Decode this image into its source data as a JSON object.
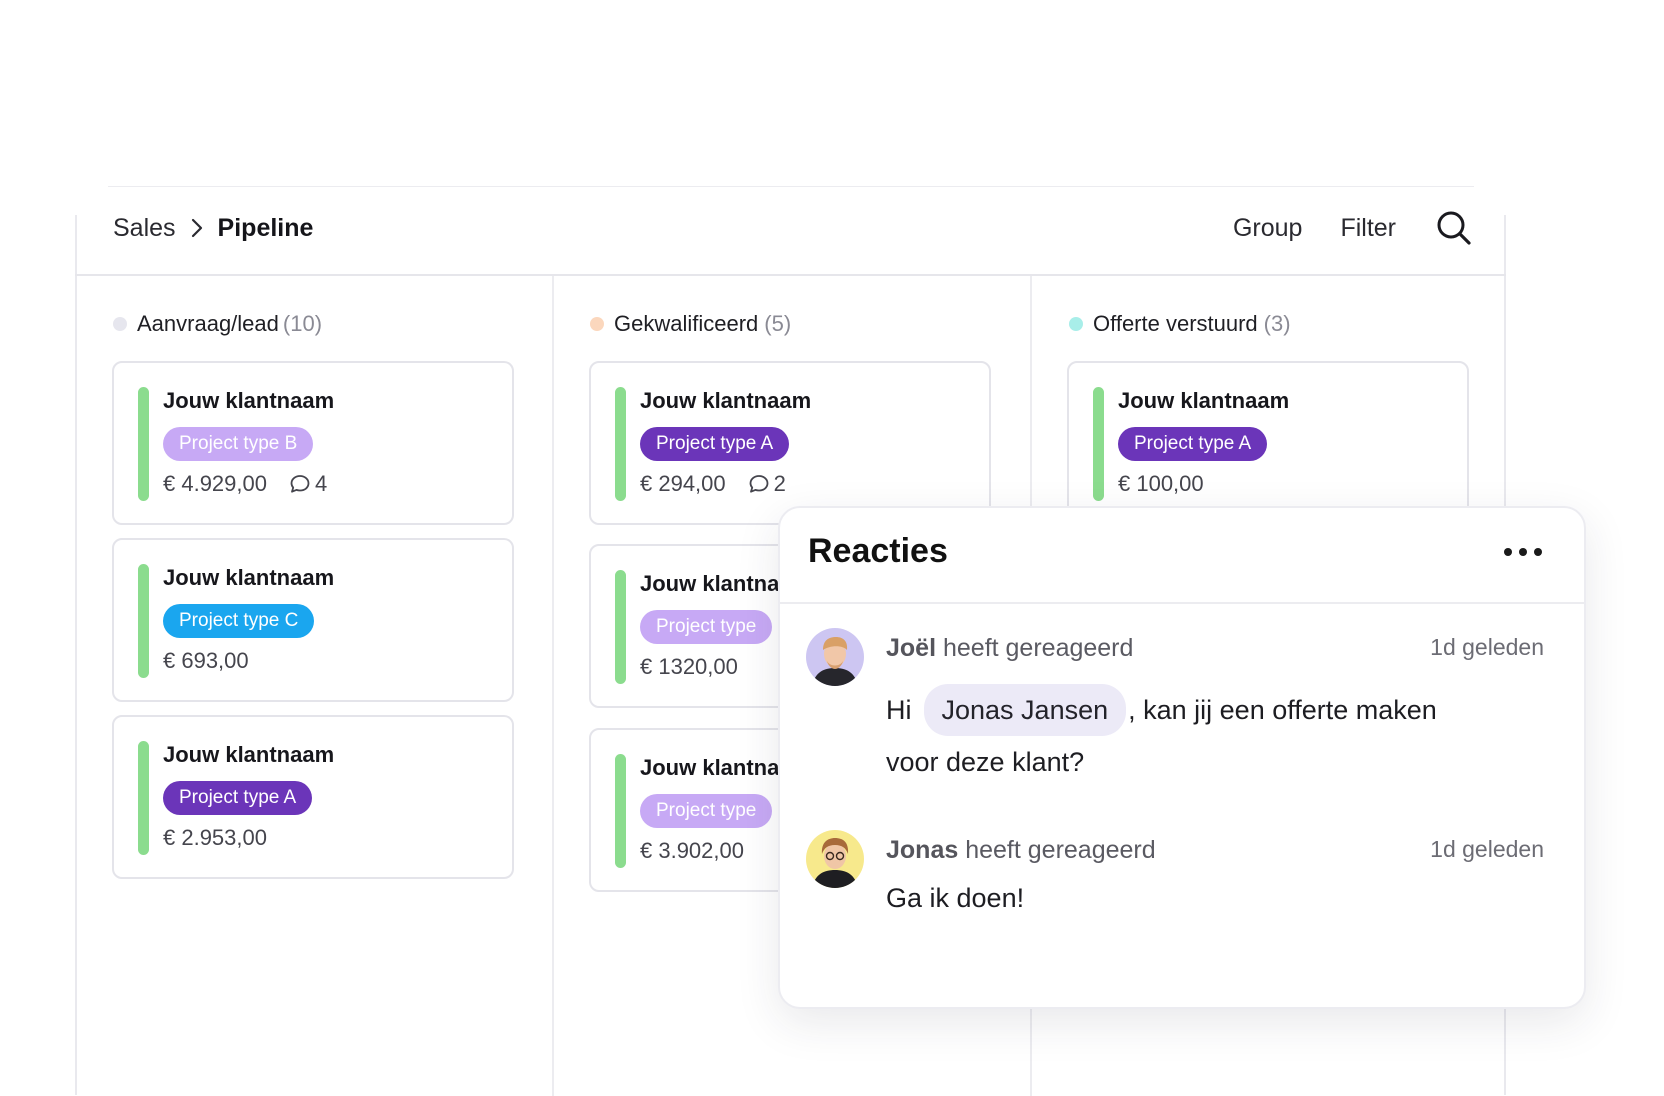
{
  "breadcrumb": {
    "parent": "Sales",
    "current": "Pipeline"
  },
  "toolbar": {
    "group": "Group",
    "filter": "Filter"
  },
  "columns": [
    {
      "name": "Aanvraag/lead",
      "count": "(10)",
      "dot_color": "#e6e6ee"
    },
    {
      "name": "Gekwalificeerd",
      "count": "(5)",
      "dot_color": "#fbd7bd"
    },
    {
      "name": "Offerte verstuurd",
      "count": "(3)",
      "dot_color": "#a8eee9"
    }
  ],
  "cards": [
    {
      "client": "Jouw klantnaam",
      "tag": "Project type B",
      "amount": "€ 4.929,00",
      "comments": "4"
    },
    {
      "client": "Jouw klantnaam",
      "tag": "Project type C",
      "amount": "€ 693,00"
    },
    {
      "client": "Jouw klantnaam",
      "tag": "Project type A",
      "amount": "€ 2.953,00"
    },
    {
      "client": "Jouw klantnaam",
      "tag": "Project type A",
      "amount": "€ 294,00",
      "comments": "2"
    },
    {
      "client": "Jouw klantnaam",
      "tag": "Project type",
      "amount": "€ 1320,00"
    },
    {
      "client": "Jouw klantnaam",
      "tag": "Project type",
      "amount": "€ 3.902,00"
    },
    {
      "client": "Jouw klantnaam",
      "tag": "Project type A",
      "amount": "€ 100,00"
    }
  ],
  "reactions": {
    "title": "Reacties",
    "comments": [
      {
        "author": "Joël",
        "action": "heeft gereageerd",
        "time": "1d geleden",
        "text_before": "Hi",
        "mention": "Jonas Jansen",
        "text_after": ", kan jij een offerte maken",
        "text_line2": "voor deze klant?"
      },
      {
        "author": "Jonas",
        "action": "heeft gereageerd",
        "time": "1d geleden",
        "text": "Ga ik doen!"
      }
    ]
  },
  "colors": {
    "card_bar": "#8bdc8e",
    "tag_a": "#6b35b9",
    "tag_b": "#c7a9f5",
    "tag_c": "#1aa6ef",
    "mention_bg": "#eceaf7"
  }
}
